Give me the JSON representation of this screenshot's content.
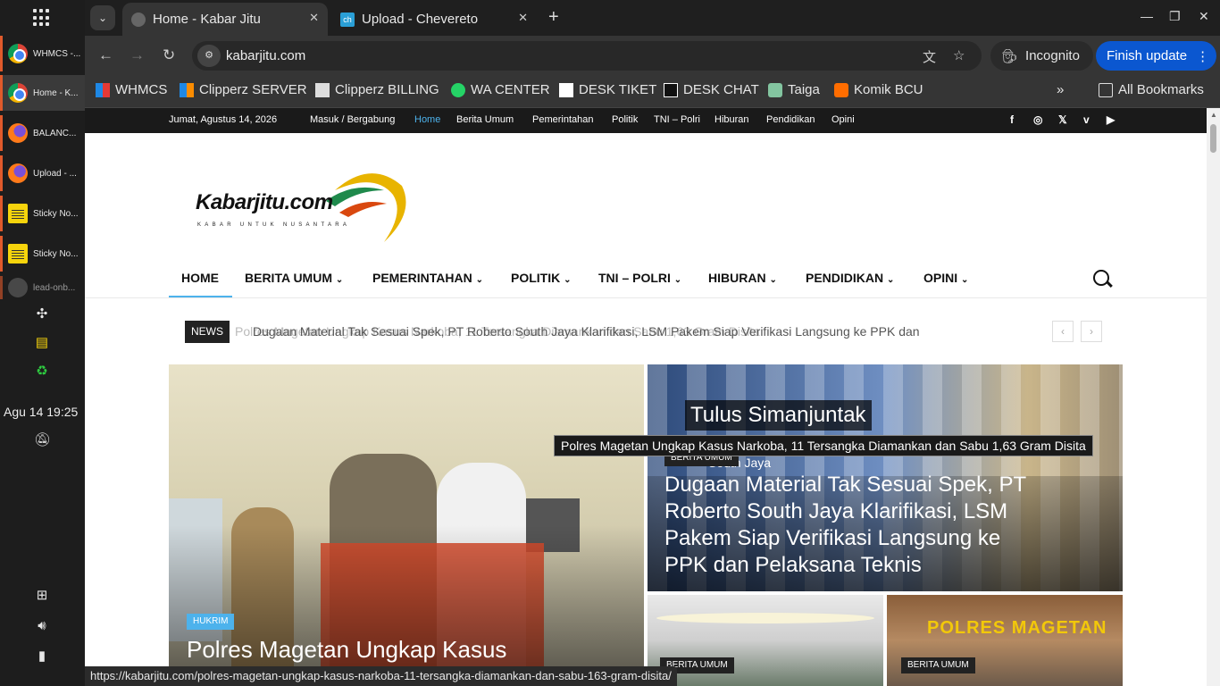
{
  "taskbar": {
    "items": [
      {
        "label": "WHMCS -...",
        "icon": "chrome-icon"
      },
      {
        "label": "Home - K...",
        "icon": "chrome-icon"
      },
      {
        "label": "BALANC...",
        "icon": "firefox-icon"
      },
      {
        "label": "Upload - ...",
        "icon": "firefox-icon"
      },
      {
        "label": "Sticky No...",
        "icon": "sticky-notes-icon"
      },
      {
        "label": "Sticky No...",
        "icon": "sticky-notes-icon"
      },
      {
        "label": "lead-onb...",
        "icon": "app-icon"
      }
    ],
    "clock": "Agu 14  19:25"
  },
  "browser": {
    "tabs": [
      {
        "title": "Home - Kabar Jitu"
      },
      {
        "title": "Upload - Chevereto"
      }
    ],
    "url": "kabarjitu.com",
    "incognito_label": "Incognito",
    "finish_update_label": "Finish update",
    "bookmarks": [
      "WHMCS",
      "Clipperz SERVER",
      "Clipperz BILLING",
      "WA CENTER",
      "DESK TIKET",
      "DESK CHAT",
      "Taiga",
      "Komik BCU"
    ],
    "all_bookmarks_label": "All Bookmarks",
    "status_url": "https://kabarjitu.com/polres-magetan-ungkap-kasus-narkoba-11-tersangka-diamankan-dan-sabu-163-gram-disita/"
  },
  "site": {
    "topbar": {
      "date": "Jumat, Agustus 14, 2026",
      "login": "Masuk / Bergabung",
      "links": [
        "Home",
        "Berita Umum",
        "Pemerintahan",
        "Politik",
        "TNI – Polri",
        "Hiburan",
        "Pendidikan",
        "Opini"
      ]
    },
    "logo": {
      "name": "Kabarjitu.com",
      "tagline": "KABAR UNTUK NUSANTARA"
    },
    "nav": [
      "HOME",
      "BERITA UMUM",
      "PEMERINTAHAN",
      "POLITIK",
      "TNI – POLRI",
      "HIBURAN",
      "PENDIDIKAN",
      "OPINI"
    ],
    "ticker": {
      "label": "NEWS",
      "text_back": "Polres Magetan Ungkap Kasus Narkoba, 11 Tersangka Diamankan dan Sabu 1,63 Gram Disita",
      "text_front": "Dugaan Material Tak Sesuai Spek, PT Roberto South Jaya Klarifikasi, LSM Pakem Siap Verifikasi Langsung ke PPK dan"
    },
    "featured": [
      {
        "category": "HUKRIM",
        "title": "Polres Magetan Ungkap Kasus"
      },
      {
        "category": "BERITA UMUM",
        "title": "Dugaan Material Tak Sesuai Spek, PT Roberto South Jaya Klarifikasi, LSM Pakem Siap Verifikasi Langsung ke PPK dan Pelaksana Teknis",
        "image_caption_1": "Tulus Simanjuntak",
        "image_caption_2": "South Jaya"
      },
      {
        "category": "BERITA UMUM",
        "title": ""
      },
      {
        "category": "BERITA UMUM",
        "title": "",
        "image_sign": "POLRES MAGETAN"
      }
    ],
    "tooltip": "Polres Magetan Ungkap Kasus Narkoba, 11 Tersangka Diamankan dan Sabu 1,63 Gram Disita"
  }
}
